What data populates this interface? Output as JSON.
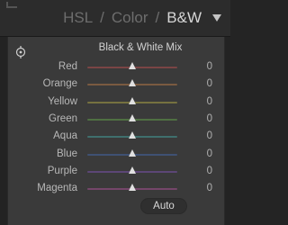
{
  "header": {
    "tabs": [
      {
        "label": "HSL",
        "active": false
      },
      {
        "label": "Color",
        "active": false
      },
      {
        "label": "B&W",
        "active": true
      }
    ],
    "separator": "/"
  },
  "panel": {
    "title": "Black & White Mix",
    "sliders": [
      {
        "label": "Red",
        "value": "0",
        "track_color": "#7a4545"
      },
      {
        "label": "Orange",
        "value": "0",
        "track_color": "#7a5a40"
      },
      {
        "label": "Yellow",
        "value": "0",
        "track_color": "#76713f"
      },
      {
        "label": "Green",
        "value": "0",
        "track_color": "#4f7042"
      },
      {
        "label": "Aqua",
        "value": "0",
        "track_color": "#3f6f6d"
      },
      {
        "label": "Blue",
        "value": "0",
        "track_color": "#3f5173"
      },
      {
        "label": "Purple",
        "value": "0",
        "track_color": "#5c4676"
      },
      {
        "label": "Magenta",
        "value": "0",
        "track_color": "#74466a"
      }
    ],
    "auto_label": "Auto"
  }
}
